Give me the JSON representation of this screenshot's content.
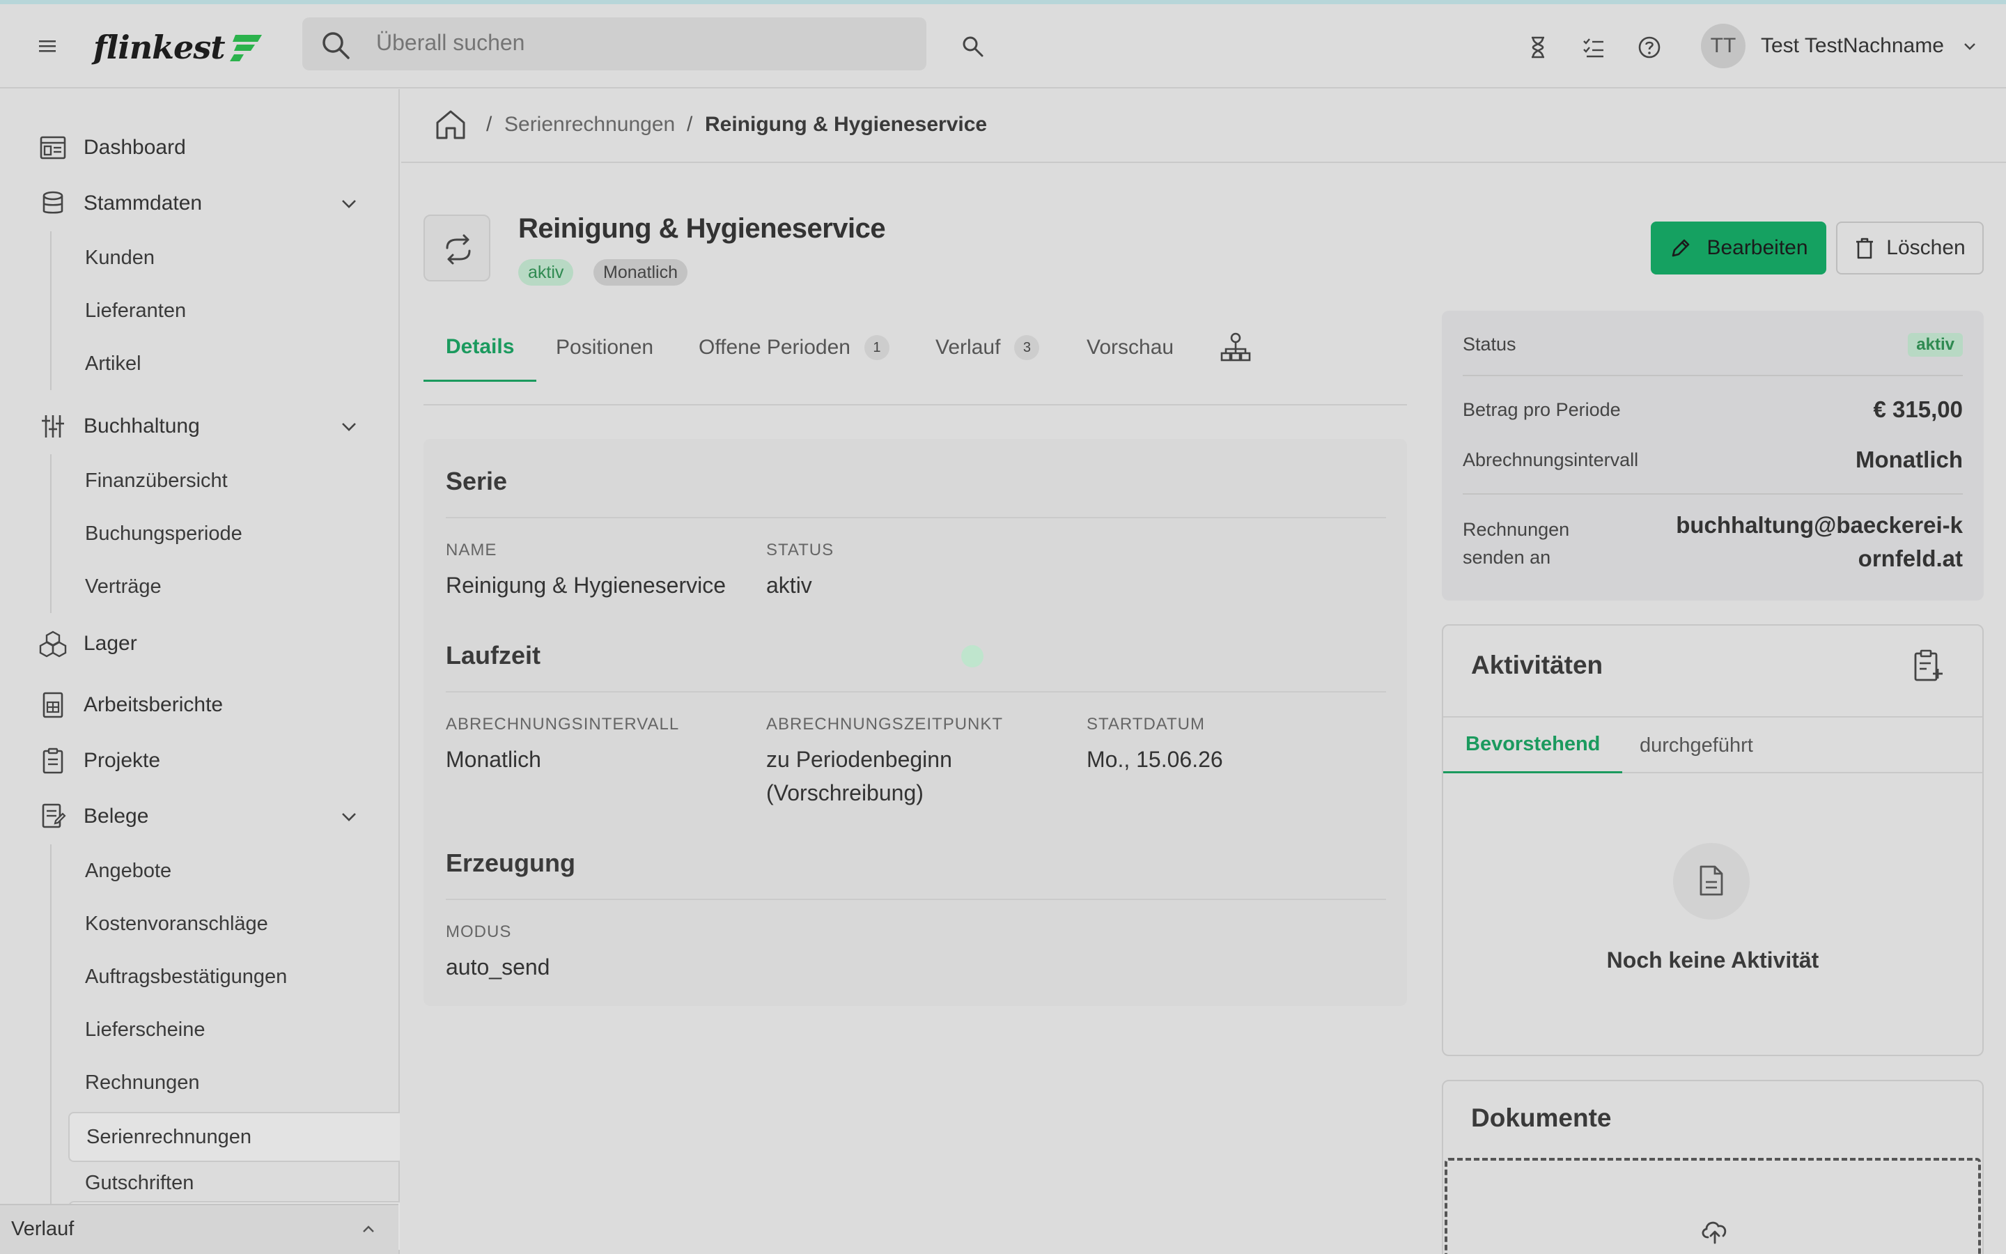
{
  "app": {
    "logo_text": "flinkest",
    "accent_color": "#1b9a5e",
    "brand_color": "#2bb24c"
  },
  "header": {
    "search_placeholder": "Überall suchen",
    "icons": [
      "hourglass-icon",
      "task-list-icon",
      "help-icon"
    ],
    "user": {
      "initials": "TT",
      "name": "Test TestNachname"
    }
  },
  "sidebar": {
    "items": [
      {
        "label": "Dashboard",
        "icon": "dashboard-icon"
      },
      {
        "label": "Stammdaten",
        "icon": "database-icon",
        "expanded": true,
        "children": [
          "Kunden",
          "Lieferanten",
          "Artikel"
        ]
      },
      {
        "label": "Buchhaltung",
        "icon": "sliders-icon",
        "expanded": true,
        "children": [
          "Finanzübersicht",
          "Buchungsperiode",
          "Verträge"
        ]
      },
      {
        "label": "Lager",
        "icon": "boxes-icon"
      },
      {
        "label": "Arbeitsberichte",
        "icon": "report-icon"
      },
      {
        "label": "Projekte",
        "icon": "clipboard-icon"
      },
      {
        "label": "Belege",
        "icon": "document-icon",
        "expanded": true,
        "children": [
          "Angebote",
          "Kostenvoranschläge",
          "Auftragsbestätigungen",
          "Lieferscheine",
          "Rechnungen",
          "Serienrechnungen",
          "Gutschriften"
        ]
      }
    ],
    "active_item": "Serienrechnungen",
    "footer_label": "Verlauf"
  },
  "breadcrumb": {
    "sep": "/",
    "items": [
      "Serienrechnungen",
      "Reinigung & Hygieneservice"
    ]
  },
  "page": {
    "title": "Reinigung & Hygieneservice",
    "badges": [
      "aktiv",
      "Monatlich"
    ],
    "edit_label": "Bearbeiten",
    "delete_label": "Löschen"
  },
  "tabs": [
    {
      "label": "Details",
      "active": true
    },
    {
      "label": "Positionen"
    },
    {
      "label": "Offene Perioden",
      "count": "1"
    },
    {
      "label": "Verlauf",
      "count": "3"
    },
    {
      "label": "Vorschau"
    }
  ],
  "details": {
    "serie": {
      "title": "Serie",
      "name_label": "Name",
      "name_value": "Reinigung & Hygieneservice",
      "status_label": "Status",
      "status_value": "aktiv"
    },
    "laufzeit": {
      "title": "Laufzeit",
      "interval_label": "Abrechnungsintervall",
      "interval_value": "Monatlich",
      "zeitpunkt_label": "Abrechnungszeitpunkt",
      "zeitpunkt_value": "zu Periodenbeginn (Vorschreibung)",
      "start_label": "Startdatum",
      "start_value": "Mo., 15.06.26"
    },
    "erzeugung": {
      "title": "Erzeugung",
      "modus_label": "Modus",
      "modus_value": "auto_send"
    }
  },
  "summary": {
    "status_label": "Status",
    "status_value": "aktiv",
    "betrag_label": "Betrag pro Periode",
    "betrag_value": "€ 315,00",
    "intervall_label": "Abrechnungsintervall",
    "intervall_value": "Monatlich",
    "rechnungen_label": "Rechnungen senden an",
    "rechnungen_value": "buchhaltung@baeckerei-kornfeld.at"
  },
  "activities": {
    "title": "Aktivitäten",
    "tabs": [
      "Bevorstehend",
      "durchgeführt"
    ],
    "empty_text": "Noch keine Aktivität"
  },
  "documents": {
    "title": "Dokumente"
  }
}
